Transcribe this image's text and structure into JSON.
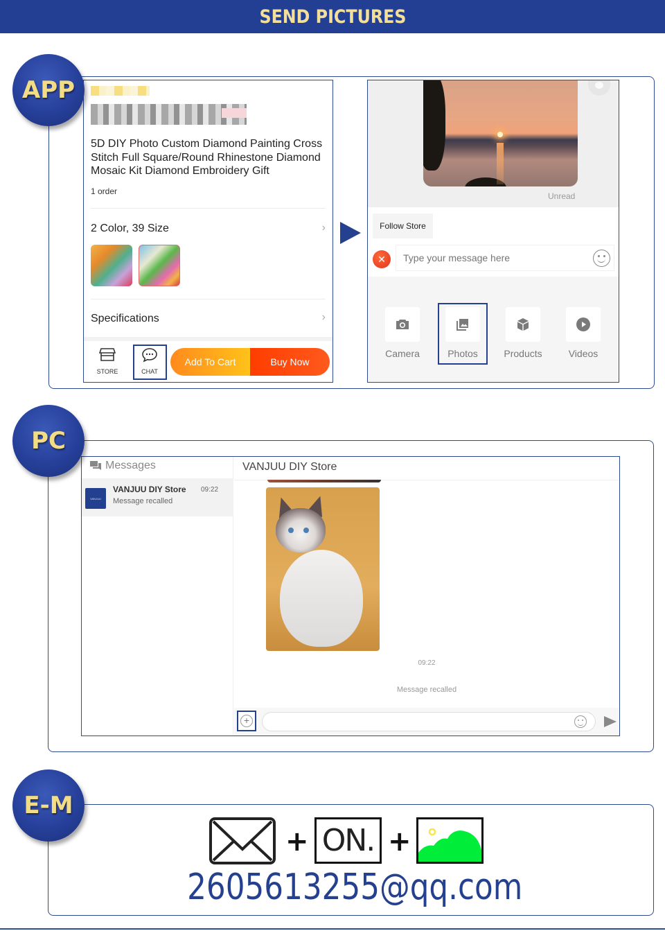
{
  "banner": {
    "title": "SEND PICTURES"
  },
  "sections": {
    "app": {
      "badge": "APP"
    },
    "pc": {
      "badge": "PC"
    },
    "email": {
      "badge": "E-M"
    }
  },
  "app_product": {
    "title": "5D DIY Photo Custom Diamond Painting Cross Stitch Full Square/Round Rhinestone Diamond Mosaic Kit Diamond Embroidery Gift",
    "orders": "1 order",
    "variants_label": "2 Color, 39 Size",
    "specifications_label": "Specifications",
    "chevron": "›",
    "bottom_bar": {
      "store_label": "STORE",
      "chat_label": "CHAT",
      "add_to_cart": "Add To Cart",
      "buy_now": "Buy Now"
    }
  },
  "app_chat": {
    "status": "Unread",
    "follow_store": "Follow Store",
    "input_placeholder": "Type your message here",
    "tools": [
      {
        "label": "Camera",
        "icon": "camera-icon"
      },
      {
        "label": "Photos",
        "icon": "photos-icon"
      },
      {
        "label": "Products",
        "icon": "products-icon"
      },
      {
        "label": "Videos",
        "icon": "video-icon"
      }
    ]
  },
  "pc_chat": {
    "sidebar_title": "Messages",
    "conversation": {
      "logo_text": "VANJUU",
      "name": "VANJUU DIY Store",
      "time": "09:22",
      "last_message": "Message recalled"
    },
    "header_title": "VANJUU DIY Store",
    "timestamp": "09:22",
    "system_message": "Message recalled",
    "plus": "+"
  },
  "email_section": {
    "on_label": "ON.",
    "plus": "+",
    "address": "2605613255@qq.com"
  },
  "colors": {
    "brand_blue": "#24408e",
    "banner_text": "#f4df9a",
    "cart_orange": "#ff8a1d",
    "buy_red": "#ff3d00",
    "email_green": "#00ee3a"
  }
}
